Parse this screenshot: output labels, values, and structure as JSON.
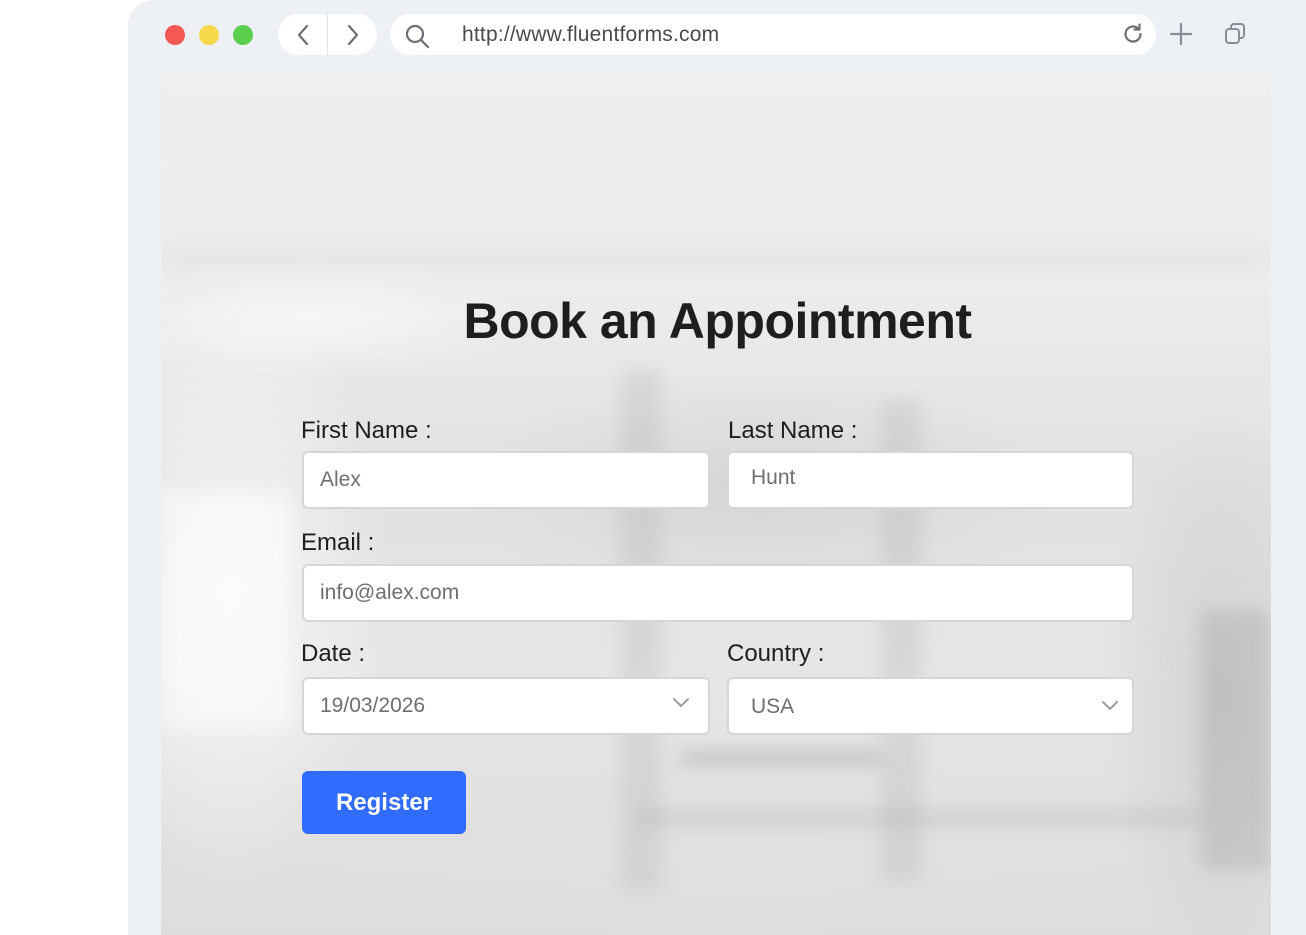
{
  "browser": {
    "url": "http://www.fluentforms.com"
  },
  "form": {
    "title": "Book an Appointment",
    "first_name": {
      "label": "First Name :",
      "value": "Alex"
    },
    "last_name": {
      "label": "Last Name :",
      "value": "Hunt"
    },
    "email": {
      "label": "Email :",
      "value": "info@alex.com"
    },
    "date": {
      "label": "Date :",
      "value": "19/03/2026"
    },
    "country": {
      "label": "Country :",
      "value": "USA"
    },
    "submit_label": "Register"
  },
  "colors": {
    "accent": "#2f6cff",
    "close_dot": "#f55752",
    "minimize_dot": "#f7d84b",
    "maximize_dot": "#59cf4d"
  }
}
